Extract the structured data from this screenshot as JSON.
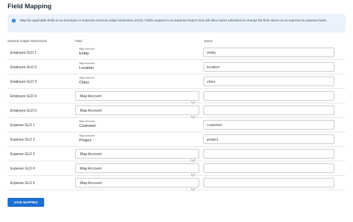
{
  "page": {
    "title": "Field Mapping",
    "info_text": "Map the applicable fields to an Employee or Expense General Ledger Dimension (GLD). Fields mapped to an Expense Report GLD will allow report submitters to change the field values on an expense by expense basis."
  },
  "columns": {
    "gld": "General Ledger Dimensions",
    "field": "Field",
    "name": "Name"
  },
  "rows": [
    {
      "label": "Employee GLD 1",
      "type": "static",
      "caption": "Map Account",
      "field": "Entity",
      "name": "entity"
    },
    {
      "label": "Employee GLD 2",
      "type": "static",
      "caption": "Map Account",
      "field": "Location",
      "name": "location"
    },
    {
      "label": "Employee GLD 3",
      "type": "static",
      "caption": "Map Account",
      "field": "Class",
      "name": "class"
    },
    {
      "label": "Employee GLD 4",
      "type": "select",
      "field": "Map Account",
      "name": ""
    },
    {
      "label": "Employee GLD 5",
      "type": "select",
      "field": "Map Account",
      "name": ""
    },
    {
      "label": "Expense GLD 1",
      "type": "static",
      "caption": "Map Account",
      "field": "Customer",
      "name": "customer"
    },
    {
      "label": "Expense GLD 2",
      "type": "static",
      "caption": "Map Account",
      "field": "Project",
      "name": "project"
    },
    {
      "label": "Expense GLD 3",
      "type": "select",
      "field": "Map Account",
      "name": ""
    },
    {
      "label": "Expense GLD 4",
      "type": "select",
      "field": "Map Account",
      "name": ""
    },
    {
      "label": "Expense GLD 5",
      "type": "select",
      "field": "Map Account",
      "name": ""
    }
  ],
  "actions": {
    "save_label": "SAVE MAPPING"
  },
  "colors": {
    "accent": "#1e6fd1",
    "info_bg": "#eaf2fb"
  },
  "icons": {
    "info": "info-icon",
    "caret": "chevron-down-icon"
  }
}
